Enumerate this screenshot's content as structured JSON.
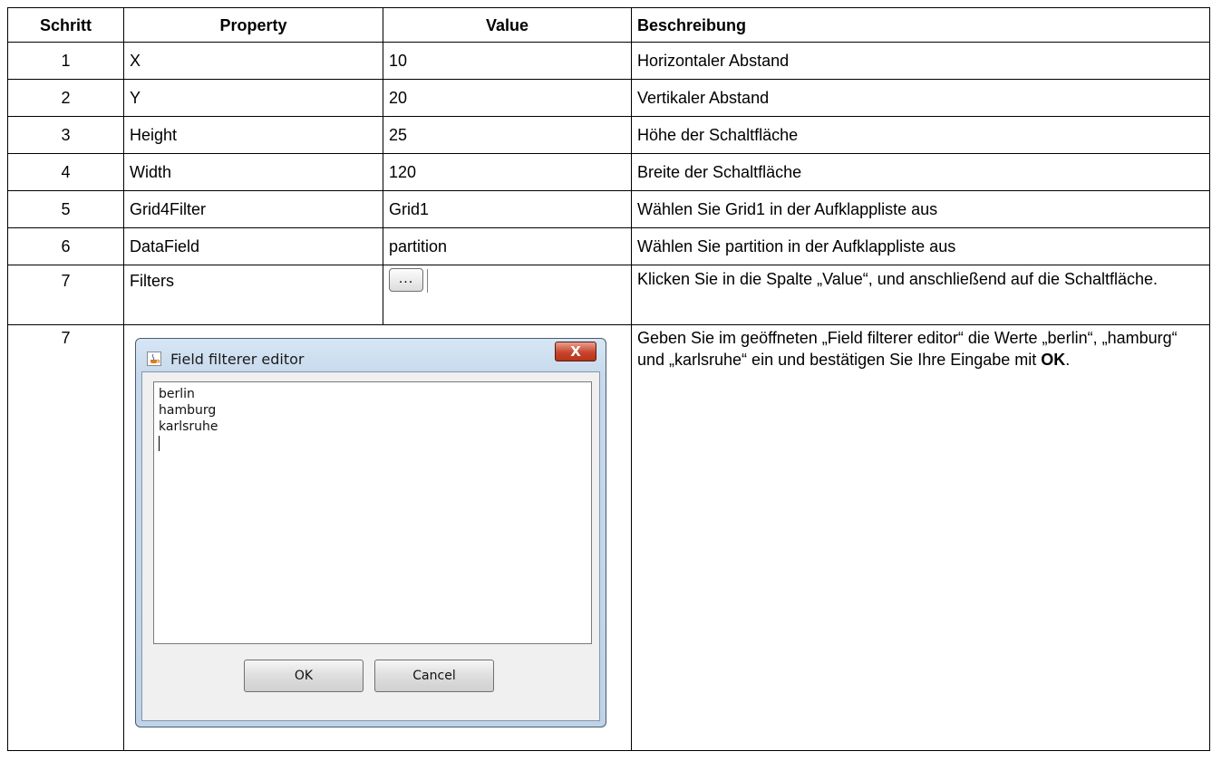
{
  "table": {
    "headers": {
      "step": "Schritt",
      "property": "Property",
      "value": "Value",
      "description": "Beschreibung"
    },
    "rows": [
      {
        "step": "1",
        "property": "X",
        "value": "10",
        "description": "Horizontaler Abstand"
      },
      {
        "step": "2",
        "property": "Y",
        "value": "20",
        "description": "Vertikaler Abstand"
      },
      {
        "step": "3",
        "property": "Height",
        "value": "25",
        "description": "Höhe der Schaltfläche"
      },
      {
        "step": "4",
        "property": "Width",
        "value": "120",
        "description": "Breite der Schaltfläche"
      },
      {
        "step": "5",
        "property": "Grid4Filter",
        "value": "Grid1",
        "description": "Wählen Sie Grid1 in der Aufklappliste aus"
      },
      {
        "step": "6",
        "property": "DataField",
        "value": "partition",
        "description": "Wählen Sie partition in der Aufklappliste aus"
      },
      {
        "step": "7",
        "property": "Filters",
        "value_button": "...",
        "description": "Klicken Sie in die Spalte „Value“, und anschließend auf die Schaltfläche."
      },
      {
        "step": "7",
        "description_before": "Geben Sie im geöffneten „Field filterer editor“ die Werte „berlin“, „hamburg“ und „karlsruhe“ ein und bestätigen Sie Ihre Eingabe mit ",
        "description_bold": "OK",
        "description_after": "."
      }
    ]
  },
  "dialog": {
    "title": "Field filterer editor",
    "close_label": "X",
    "app_icon": "java-cup-icon",
    "text_lines": [
      "berlin",
      "hamburg",
      "karlsruhe"
    ],
    "ok_label": "OK",
    "cancel_label": "Cancel"
  },
  "colors": {
    "dialog_frame": "#c7d9ec",
    "close_button": "#c8452c",
    "border": "#000000"
  }
}
